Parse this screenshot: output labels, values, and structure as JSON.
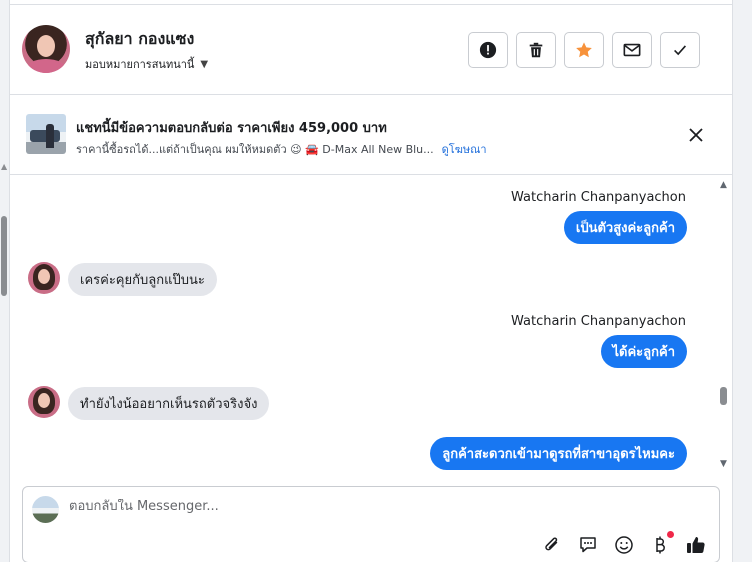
{
  "header": {
    "contact_name": "สุกัลยา กองแซง",
    "assign_label": "มอบหมายการสนทนานี้"
  },
  "ad": {
    "title": "แชทนี้มีข้อความตอบกลับต่อ ราคาเพียง 459,000 บาท",
    "subtitle": "ราคานี้ซื้อรถได้...แต่ถ้าเป็นคุณ ผมให้หมดตัว 😉 🚘 D-Max All New Blu...",
    "link": "ดูโฆษณา"
  },
  "messages": [
    {
      "direction": "out",
      "sender": "Watcharin Chanpanyachon",
      "text": "เป็นตัวสูงค่ะลูกค้า"
    },
    {
      "direction": "in",
      "text": "เครค่ะคุยกับลูกแป๊บนะ"
    },
    {
      "direction": "out",
      "sender": "Watcharin Chanpanyachon",
      "text": "ได้ค่ะลูกค้า"
    },
    {
      "direction": "in",
      "text": "ทำยังไงน้ออยากเห็นรถตัวจริงจัง"
    },
    {
      "direction": "out",
      "text": "ลูกค้าสะดวกเข้ามาดูรถที่สาขาอุดรไหมคะ"
    }
  ],
  "composer": {
    "placeholder": "ตอบกลับใน Messenger..."
  },
  "colors": {
    "accent": "#1877f2",
    "star": "#f7923b",
    "bubble_in": "#e4e6eb",
    "notification_dot": "#f02849"
  }
}
